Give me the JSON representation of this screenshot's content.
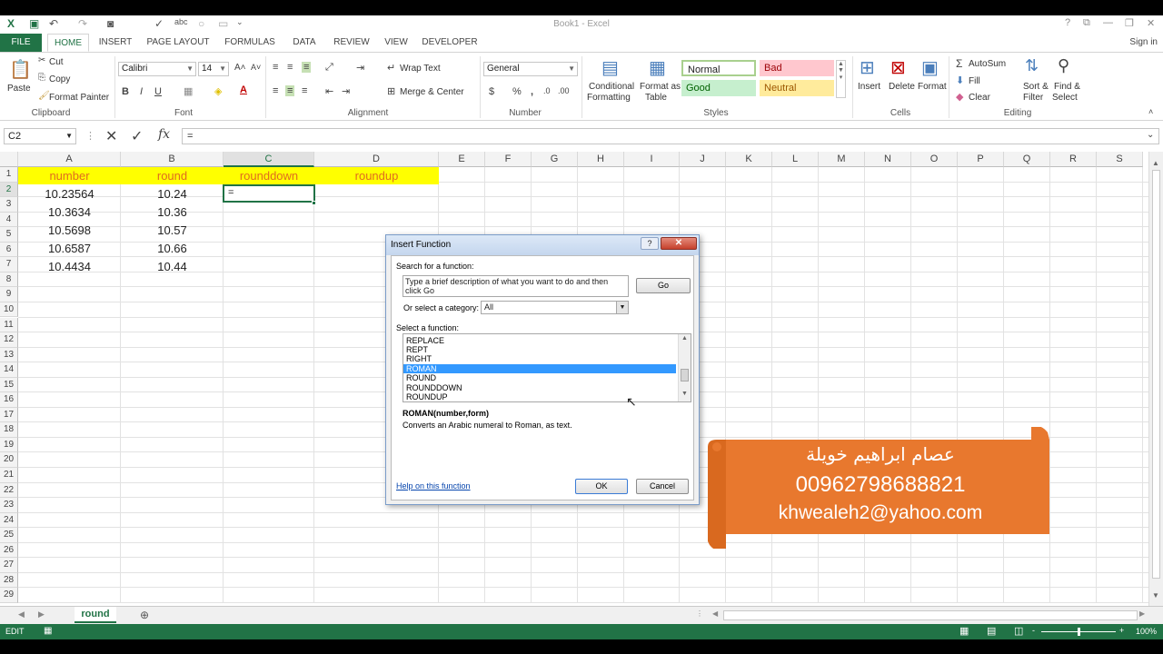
{
  "window": {
    "title": "Book1 - Excel",
    "help": "?"
  },
  "ribbon_tabs": [
    "FILE",
    "HOME",
    "INSERT",
    "PAGE LAYOUT",
    "FORMULAS",
    "DATA",
    "REVIEW",
    "VIEW",
    "DEVELOPER"
  ],
  "signin": "Sign in",
  "clipboard": {
    "paste": "Paste",
    "cut": "Cut",
    "copy": "Copy",
    "format_painter": "Format Painter",
    "label": "Clipboard"
  },
  "font": {
    "family": "Calibri",
    "size": "14",
    "label": "Font",
    "bold": "B",
    "italic": "I",
    "underline": "U"
  },
  "alignment": {
    "wrap": "Wrap Text",
    "merge": "Merge & Center",
    "label": "Alignment"
  },
  "number": {
    "format": "General",
    "currency": "$",
    "percent": "%",
    "comma": ",",
    "label": "Number"
  },
  "styles": {
    "conditional": "Conditional",
    "formatting": "Formatting",
    "format_as": "Format as",
    "table": "Table",
    "normal": "Normal",
    "bad": "Bad",
    "good": "Good",
    "neutral": "Neutral",
    "label": "Styles",
    "colors": {
      "bad_bg": "#ffc7ce",
      "bad_fg": "#9c0006",
      "good_bg": "#c6efce",
      "good_fg": "#006100",
      "neutral_bg": "#ffeb9c",
      "neutral_fg": "#9c5700"
    }
  },
  "cells_group": {
    "insert": "Insert",
    "delete": "Delete",
    "format": "Format",
    "label": "Cells"
  },
  "editing": {
    "autosum": "AutoSum",
    "fill": "Fill",
    "clear": "Clear",
    "sort": "Sort &",
    "filter": "Filter",
    "find": "Find &",
    "select": "Select",
    "label": "Editing"
  },
  "formula_bar": {
    "name_box": "C2",
    "fx": "fx",
    "value": "="
  },
  "columns": [
    "A",
    "B",
    "C",
    "D",
    "E",
    "F",
    "G",
    "H",
    "I",
    "J",
    "K",
    "L",
    "M",
    "N",
    "O",
    "P",
    "Q",
    "R",
    "S"
  ],
  "rows": [
    "1",
    "2",
    "3",
    "4",
    "5",
    "6",
    "7",
    "8",
    "9",
    "10",
    "11",
    "12",
    "13",
    "14",
    "15",
    "16",
    "17",
    "18",
    "19",
    "20",
    "21",
    "22",
    "23",
    "24",
    "25",
    "26",
    "27",
    "28",
    "29"
  ],
  "sheet": {
    "headers": [
      "number",
      "round",
      "rounddown",
      "roundup"
    ],
    "numbers": [
      "10.23564",
      "10.3634",
      "10.5698",
      "10.6587",
      "10.4434"
    ],
    "rounded": [
      "10.24",
      "10.36",
      "10.57",
      "10.66",
      "10.44"
    ],
    "active_value": "="
  },
  "sheet_tab": "round",
  "status": {
    "mode": "EDIT",
    "zoom": "100%",
    "minus": "-",
    "plus": "+"
  },
  "dialog": {
    "title": "Insert Function",
    "search_label": "Search for a function:",
    "search_text": "Type a brief description of what you want to do and then click Go",
    "go": "Go",
    "category_label": "Or select a category:",
    "category": "All",
    "select_label": "Select a function:",
    "functions": [
      "REPLACE",
      "REPT",
      "RIGHT",
      "ROMAN",
      "ROUND",
      "ROUNDDOWN",
      "ROUNDUP"
    ],
    "selected": "ROMAN",
    "signature": "ROMAN(number,form)",
    "description": "Converts an Arabic numeral to Roman, as text.",
    "help_link": "Help on this function",
    "ok": "OK",
    "cancel": "Cancel"
  },
  "banner": {
    "name": "عصام ابراهيم خويلة",
    "phone": "00962798688821",
    "email": "khwealeh2@yahoo.com",
    "color": "#e8782e"
  }
}
